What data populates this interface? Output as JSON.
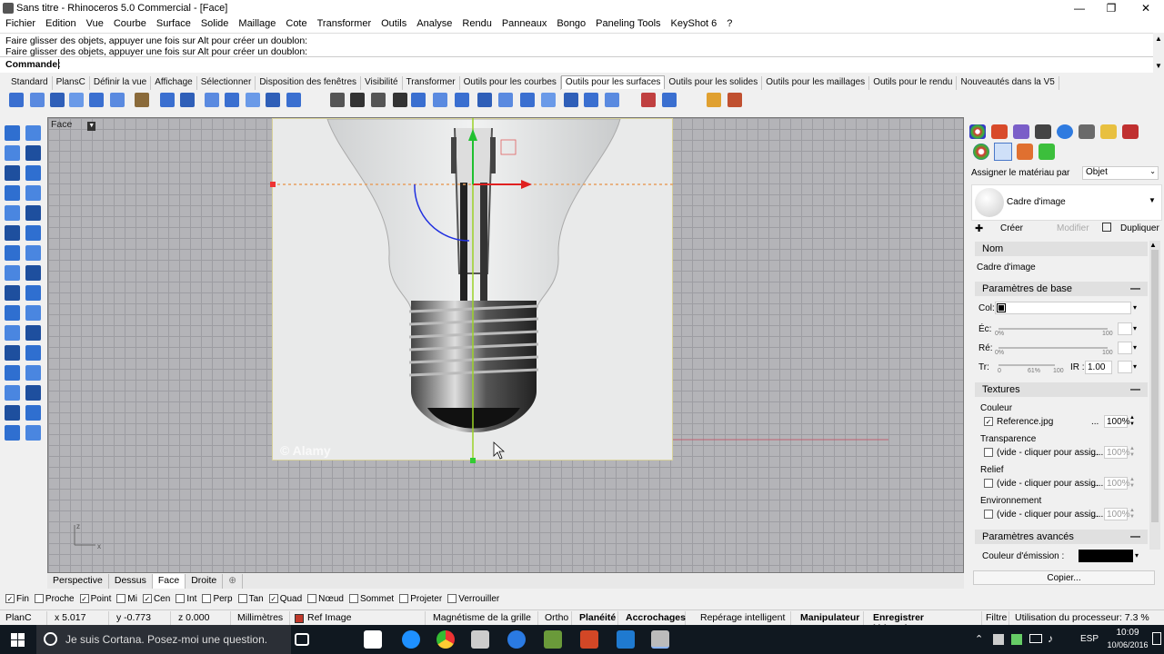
{
  "window": {
    "title": "Sans titre - Rhinoceros 5.0 Commercial - [Face]"
  },
  "menu": [
    "Fichier",
    "Edition",
    "Vue",
    "Courbe",
    "Surface",
    "Solide",
    "Maillage",
    "Cote",
    "Transformer",
    "Outils",
    "Analyse",
    "Rendu",
    "Panneaux",
    "Bongo",
    "Paneling Tools",
    "KeyShot 6",
    "?"
  ],
  "command": {
    "history_1": "Faire glisser des objets, appuyer une fois sur Alt pour créer un doublon:",
    "history_2": "Faire glisser des objets, appuyer une fois sur Alt pour créer un doublon:",
    "prompt": "Commande:"
  },
  "toolbar_tabs": [
    "Standard",
    "PlansC",
    "Définir la vue",
    "Affichage",
    "Sélectionner",
    "Disposition des fenêtres",
    "Visibilité",
    "Transformer",
    "Outils pour les courbes",
    "Outils pour les surfaces",
    "Outils pour les solides",
    "Outils pour les maillages",
    "Outils  pour le rendu",
    "Nouveautés dans la V5"
  ],
  "toolbar_active": 9,
  "viewport": {
    "title": "Face",
    "watermark": "© Alamy",
    "axis_z": "z",
    "axis_x": "x"
  },
  "viewport_tabs": [
    "Perspective",
    "Dessus",
    "Face",
    "Droite"
  ],
  "viewport_tab_active": 2,
  "viewport_tab_add": "⊕",
  "osnaps": [
    {
      "label": "Fin",
      "checked": true
    },
    {
      "label": "Proche",
      "checked": false
    },
    {
      "label": "Point",
      "checked": true
    },
    {
      "label": "Mi",
      "checked": false
    },
    {
      "label": "Cen",
      "checked": true
    },
    {
      "label": "Int",
      "checked": false
    },
    {
      "label": "Perp",
      "checked": false
    },
    {
      "label": "Tan",
      "checked": false
    },
    {
      "label": "Quad",
      "checked": true
    },
    {
      "label": "Nœud",
      "checked": false
    },
    {
      "label": "Sommet",
      "checked": false
    },
    {
      "label": "Projeter",
      "checked": false
    },
    {
      "label": "Verrouiller",
      "checked": false
    }
  ],
  "status": {
    "cplane": "PlanC",
    "x": "x 5.017",
    "y": "y -0.773",
    "z": "z 0.000",
    "units": "Millimètres",
    "layer": "Ref Image",
    "grid_snap": "Magnétisme de la grille",
    "ortho": "Ortho",
    "planar": "Planéité",
    "osnap": "Accrochages",
    "smarttrack": "Repérage intelligent",
    "gumball": "Manipulateur",
    "history": "Enregistrer l'historique",
    "filter": "Filtre",
    "cpu": "Utilisation du processeur: 7.3 %"
  },
  "panel": {
    "assign_label": "Assigner le matériau par",
    "assign_value": "Objet",
    "material_name": "Cadre d'image",
    "create": "Créer",
    "modify": "Modifier",
    "duplicate": "Dupliquer",
    "name_header": "Nom",
    "name_value": "Cadre d'image",
    "base_header": "Paramètres de base",
    "col_label": "Col:",
    "ec_label": "Éc:",
    "re_label": "Ré:",
    "tr_label": "Tr:",
    "ec_min": "0%",
    "ec_max": "100",
    "re_min": "0%",
    "re_max": "100",
    "tr_min": "0",
    "tr_mid": "61%",
    "tr_max": "100",
    "ir_label": "IR :",
    "ir_value": "1.00",
    "textures_header": "Textures",
    "tex_color_label": "Couleur",
    "tex_color_value": "Reference.jpg",
    "tex_color_pct": "100%",
    "tex_trans_label": "Transparence",
    "tex_trans_value": "(vide - cliquer pour assig...",
    "tex_trans_pct": "100%",
    "tex_relief_label": "Relief",
    "tex_relief_value": "(vide - cliquer pour assig...",
    "tex_relief_pct": "100%",
    "tex_env_label": "Environnement",
    "tex_env_value": "(vide - cliquer pour assig...",
    "tex_env_pct": "100%",
    "adv_header": "Paramètres avancés",
    "emission_label": "Couleur d'émission :",
    "copy": "Copier...",
    "dots": "..."
  },
  "taskbar": {
    "search": "Je suis Cortana. Posez-moi une question.",
    "lang": "ESP",
    "time": "10:09",
    "date": "10/06/2016"
  },
  "colors": {
    "accent": "#2f6fd0",
    "taskbar": "#101820",
    "layer": "#c0392b",
    "emission": "#000000"
  }
}
